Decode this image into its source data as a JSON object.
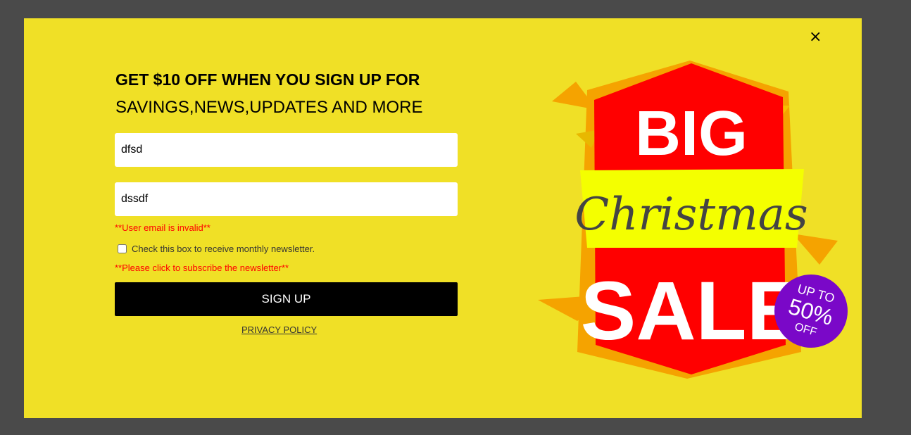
{
  "popup": {
    "close_glyph": "×",
    "heading_bold": "GET $10 OFF WHEN YOU SIGN UP FOR",
    "heading_regular": "SAVINGS,NEWS,UPDATES AND MORE",
    "name_field_value": "dfsd",
    "email_field_value": "dssdf",
    "email_error": "**User email is invalid**",
    "newsletter_checkbox_label": "Check this box to receive monthly newsletter.",
    "newsletter_checked": false,
    "newsletter_error": "**Please click to subscribe the newsletter**",
    "signup_label": "SIGN UP",
    "privacy_label": "PRIVACY POLICY"
  },
  "promo": {
    "word_big": "BIG",
    "word_christmas": "Christmas",
    "word_sale": "SALE",
    "badge_line1": "UP TO",
    "badge_line2": "50%",
    "badge_line3": "OFF"
  },
  "colors": {
    "overlay": "#4a4a4a",
    "modal_background": "#f0e026",
    "error_text": "#ff0000",
    "button_background": "#000000",
    "banner_red": "#ff0000",
    "banner_yellow_band": "#f4ff00",
    "badge_purple": "#7a08c8",
    "accent_orange": "#f5a300"
  },
  "icons": {
    "close": "close-icon"
  }
}
